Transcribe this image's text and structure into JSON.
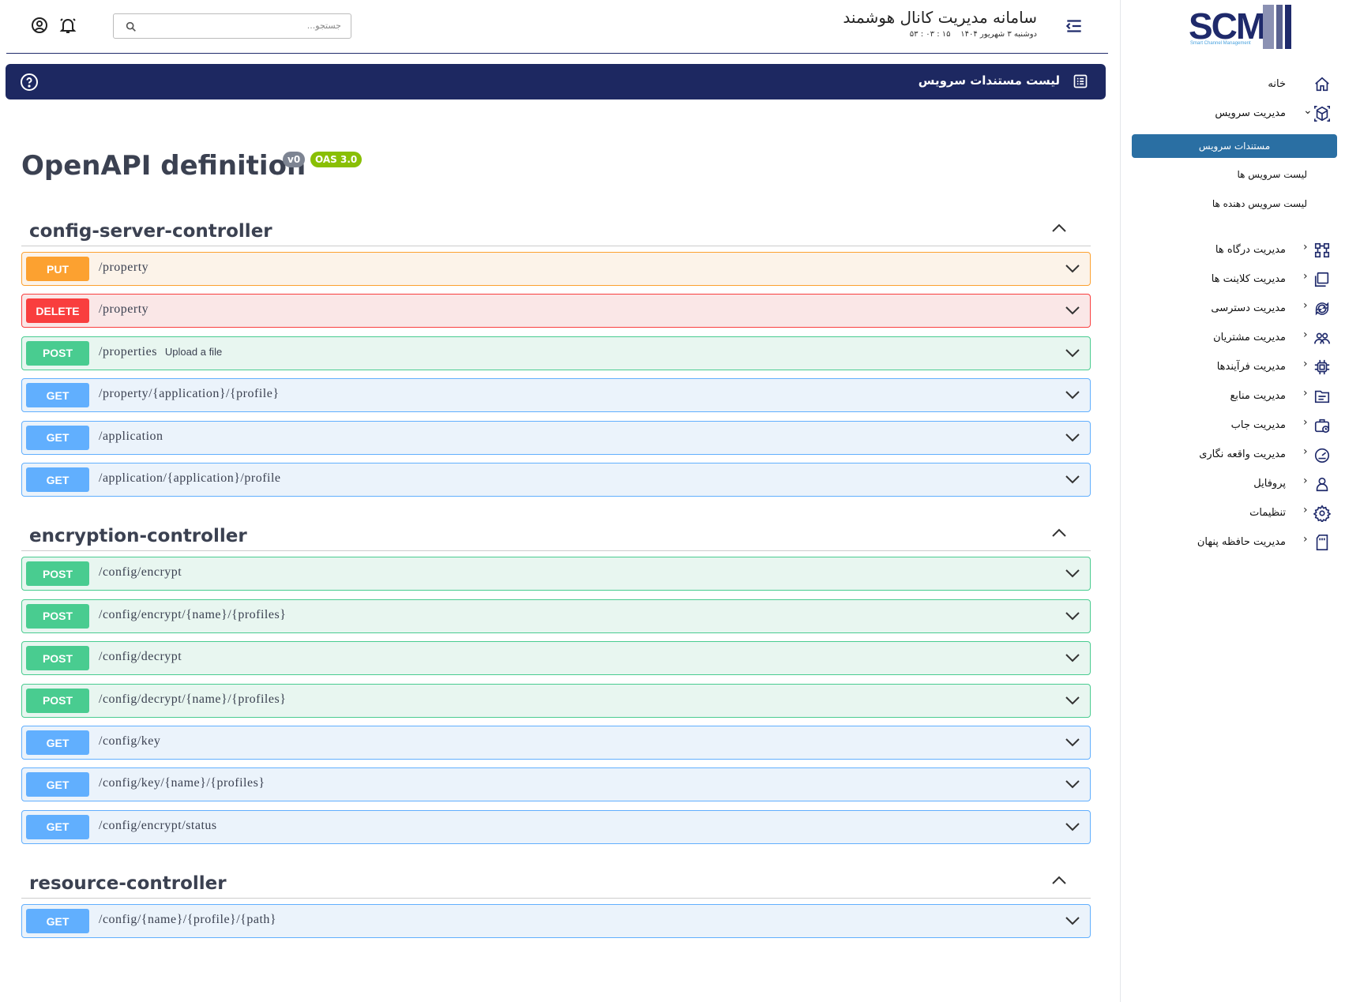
{
  "sidebar": {
    "logo_text": "SCM",
    "logo_subtitle": "Smart Channel Management",
    "items": [
      {
        "label": "خانه",
        "icon": "home-icon",
        "has_chevron": false
      },
      {
        "label": "مدیریت سرویس",
        "icon": "cube-icon",
        "has_chevron": true,
        "expanded": true
      },
      {
        "label": "مدیریت درگاه ها",
        "icon": "network-icon",
        "has_chevron": true
      },
      {
        "label": "مدیریت کلاینت ها",
        "icon": "clients-icon",
        "has_chevron": true
      },
      {
        "label": "مدیریت دسترسی",
        "icon": "access-icon",
        "has_chevron": true
      },
      {
        "label": "مدیریت مشتریان",
        "icon": "users-icon",
        "has_chevron": true
      },
      {
        "label": "مدیریت فرآیندها",
        "icon": "chip-icon",
        "has_chevron": true
      },
      {
        "label": "مدیریت منابع",
        "icon": "folder-icon",
        "has_chevron": true
      },
      {
        "label": "مدیریت جاب",
        "icon": "job-icon",
        "has_chevron": true
      },
      {
        "label": "مدیریت واقعه نگاری",
        "icon": "gauge-icon",
        "has_chevron": true
      },
      {
        "label": "پروفایل",
        "icon": "user-icon",
        "has_chevron": true
      },
      {
        "label": "تنظیمات",
        "icon": "gear-icon",
        "has_chevron": true
      },
      {
        "label": "مدیریت حافظه پنهان",
        "icon": "sd-card-icon",
        "has_chevron": true
      }
    ],
    "subitems": [
      {
        "label": "مستندات سرویس",
        "active": true
      },
      {
        "label": "لیست سرویس ها",
        "active": false
      },
      {
        "label": "لیست سرویس دهنده ها",
        "active": false
      }
    ]
  },
  "header": {
    "title": "سامانه مدیریت کانال هوشمند",
    "date": "دوشنبه ۳ شهریور ۱۴۰۴",
    "time": "۱۵ : ۰۳ : ۵۳",
    "search_placeholder": "جستجو..."
  },
  "banner": {
    "title": "لیست مستندات سرویس"
  },
  "api": {
    "title": "OpenAPI definition",
    "version_badge": "v0",
    "oas_badge": "OAS 3.0",
    "version_badge_color": "#7d8492",
    "oas_badge_color": "#89bf04"
  },
  "colors": {
    "accent": "#1d2861",
    "active_subitem": "#2a6fa3",
    "put": "#fca130",
    "delete": "#f93e3e",
    "post": "#49cc90",
    "get": "#61affe"
  },
  "tags": [
    {
      "name": "config-server-controller",
      "operations": [
        {
          "method": "PUT",
          "path": "/property",
          "summary": ""
        },
        {
          "method": "DELETE",
          "path": "/property",
          "summary": ""
        },
        {
          "method": "POST",
          "path": "/properties",
          "summary": "Upload a file"
        },
        {
          "method": "GET",
          "path": "/property/{application}/{profile}",
          "summary": ""
        },
        {
          "method": "GET",
          "path": "/application",
          "summary": ""
        },
        {
          "method": "GET",
          "path": "/application/{application}/profile",
          "summary": ""
        }
      ]
    },
    {
      "name": "encryption-controller",
      "operations": [
        {
          "method": "POST",
          "path": "/config/encrypt",
          "summary": ""
        },
        {
          "method": "POST",
          "path": "/config/encrypt/{name}/{profiles}",
          "summary": ""
        },
        {
          "method": "POST",
          "path": "/config/decrypt",
          "summary": ""
        },
        {
          "method": "POST",
          "path": "/config/decrypt/{name}/{profiles}",
          "summary": ""
        },
        {
          "method": "GET",
          "path": "/config/key",
          "summary": ""
        },
        {
          "method": "GET",
          "path": "/config/key/{name}/{profiles}",
          "summary": ""
        },
        {
          "method": "GET",
          "path": "/config/encrypt/status",
          "summary": ""
        }
      ]
    },
    {
      "name": "resource-controller",
      "operations": [
        {
          "method": "GET",
          "path": "/config/{name}/{profile}/{path}",
          "summary": ""
        }
      ]
    }
  ]
}
